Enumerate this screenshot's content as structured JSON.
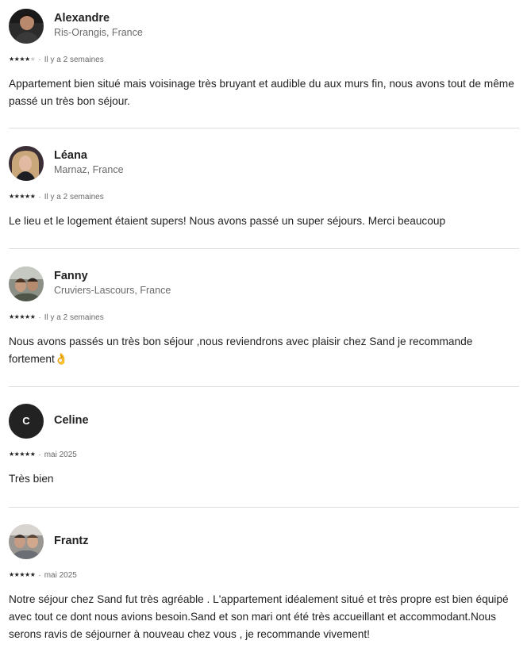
{
  "reviews": [
    {
      "name": "Alexandre",
      "location": "Ris-Orangis, France",
      "rating": 4,
      "date": "Il y a 2 semaines",
      "text": "Appartement bien situé mais voisinage très bruyant et audible du aux murs fin, nous avons tout de même passé un très bon séjour.",
      "avatar": "photo"
    },
    {
      "name": "Léana",
      "location": "Marnaz, France",
      "rating": 5,
      "date": "Il y a 2 semaines",
      "text": "Le lieu et le logement étaient supers! Nous avons passé un super séjours. Merci beaucoup",
      "avatar": "photo"
    },
    {
      "name": "Fanny",
      "location": "Cruviers-Lascours, France",
      "rating": 5,
      "date": "Il y a 2 semaines",
      "text": "Nous avons passés un très bon séjour ,nous reviendrons avec plaisir chez Sand je recommande fortement👌",
      "avatar": "photo"
    },
    {
      "name": "Celine",
      "initial": "C",
      "rating": 5,
      "date": "mai 2025",
      "text": "Très bien",
      "avatar": "initial"
    },
    {
      "name": "Frantz",
      "rating": 5,
      "date": "mai 2025",
      "text": "Notre séjour chez Sand fut très agréable . L'appartement idéalement situé et très propre est bien équipé avec tout ce dont nous avions besoin.Sand et son mari ont été très accueillant et accommodant.Nous serons ravis de séjourner à nouveau chez vous , je recommande vivement!",
      "avatar": "photo"
    }
  ],
  "separator": "·",
  "colors": {
    "text": "#222222",
    "secondary": "#6a6a6a",
    "divider": "#dddddd",
    "star_empty": "#c8c8c8"
  }
}
